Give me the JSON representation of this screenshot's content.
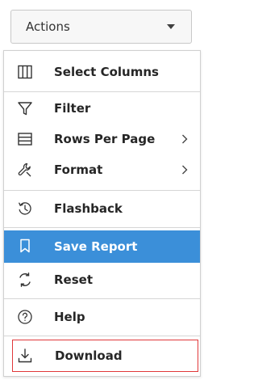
{
  "actions_button": {
    "label": "Actions",
    "icon": "caret-down-icon"
  },
  "menu": {
    "items": [
      {
        "label": "Select Columns",
        "icon": "columns-icon",
        "submenu": false
      },
      {
        "label": "Filter",
        "icon": "filter-icon",
        "submenu": false
      },
      {
        "label": "Rows Per Page",
        "icon": "rows-icon",
        "submenu": true
      },
      {
        "label": "Format",
        "icon": "wrench-icon",
        "submenu": true
      },
      {
        "label": "Flashback",
        "icon": "flashback-icon",
        "submenu": false
      },
      {
        "label": "Save Report",
        "icon": "bookmark-icon",
        "submenu": false,
        "selected": true
      },
      {
        "label": "Reset",
        "icon": "reset-icon",
        "submenu": false
      },
      {
        "label": "Help",
        "icon": "help-icon",
        "submenu": false
      },
      {
        "label": "Download",
        "icon": "download-icon",
        "submenu": false,
        "highlighted": true
      }
    ]
  },
  "colors": {
    "selected_background": "#3b8fd9",
    "highlight_border": "#e0383a",
    "text": "#262626"
  }
}
